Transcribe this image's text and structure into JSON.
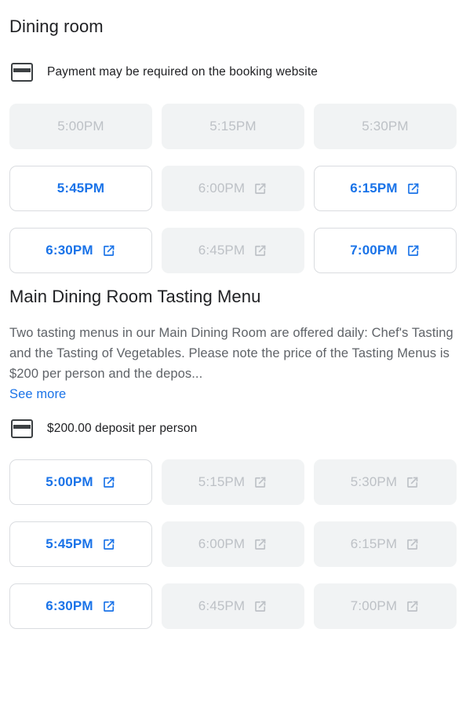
{
  "colors": {
    "accent": "#1a73e8",
    "text_primary": "#202124",
    "text_secondary": "#5f6368",
    "disabled_text": "#bdc1c6",
    "disabled_bg": "#f1f3f4",
    "border": "#dadce0"
  },
  "sections": [
    {
      "title": "Dining room",
      "note": {
        "icon": "credit-card-icon",
        "text": "Payment may be required on the booking website"
      },
      "slots": [
        {
          "time": "5:00PM",
          "available": false,
          "external_link": false
        },
        {
          "time": "5:15PM",
          "available": false,
          "external_link": false
        },
        {
          "time": "5:30PM",
          "available": false,
          "external_link": false
        },
        {
          "time": "5:45PM",
          "available": true,
          "external_link": false
        },
        {
          "time": "6:00PM",
          "available": false,
          "external_link": true
        },
        {
          "time": "6:15PM",
          "available": true,
          "external_link": true
        },
        {
          "time": "6:30PM",
          "available": true,
          "external_link": true
        },
        {
          "time": "6:45PM",
          "available": false,
          "external_link": true
        },
        {
          "time": "7:00PM",
          "available": true,
          "external_link": true
        }
      ]
    },
    {
      "title": "Main Dining Room Tasting Menu",
      "description": "Two tasting menus in our Main Dining Room are offered daily: Chef's Tasting and the Tasting of Vegetables. Please note the price of the Tasting Menus is $200 per person and the depos...",
      "see_more_label": "See more",
      "note": {
        "icon": "credit-card-icon",
        "text": "$200.00 deposit per person"
      },
      "slots": [
        {
          "time": "5:00PM",
          "available": true,
          "external_link": true
        },
        {
          "time": "5:15PM",
          "available": false,
          "external_link": true
        },
        {
          "time": "5:30PM",
          "available": false,
          "external_link": true
        },
        {
          "time": "5:45PM",
          "available": true,
          "external_link": true
        },
        {
          "time": "6:00PM",
          "available": false,
          "external_link": true
        },
        {
          "time": "6:15PM",
          "available": false,
          "external_link": true
        },
        {
          "time": "6:30PM",
          "available": true,
          "external_link": true
        },
        {
          "time": "6:45PM",
          "available": false,
          "external_link": true
        },
        {
          "time": "7:00PM",
          "available": false,
          "external_link": true
        }
      ]
    }
  ]
}
